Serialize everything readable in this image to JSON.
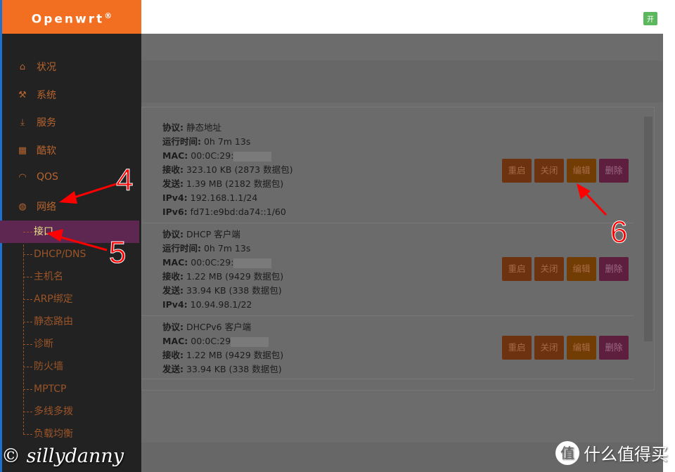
{
  "sidebar": {
    "logo": "Openwrt",
    "logo_mark": "®",
    "menu": [
      {
        "label": "状况",
        "icon": "home-icon"
      },
      {
        "label": "系统",
        "icon": "tools-icon"
      },
      {
        "label": "服务",
        "icon": "download-icon"
      },
      {
        "label": "酷软",
        "icon": "grid-icon"
      },
      {
        "label": "QOS",
        "icon": "gauge-icon"
      },
      {
        "label": "网络",
        "icon": "globe-icon"
      }
    ],
    "submenu": [
      "接口",
      "DHCP/DNS",
      "主机名",
      "ARP绑定",
      "静态路由",
      "诊断",
      "防火墙",
      "MPTCP",
      "多线多拨",
      "负载均衡"
    ],
    "active": "接口"
  },
  "header": {
    "toggle": "开"
  },
  "interfaces": [
    {
      "lines": [
        [
          "协议:",
          "静态地址"
        ],
        [
          "运行时间:",
          "0h 7m 13s"
        ],
        [
          "MAC:",
          "00:0C:29:"
        ],
        [
          "接收:",
          "323.10 KB (2873 数据包)"
        ],
        [
          "发送:",
          "1.39 MB (2182 数据包)"
        ],
        [
          "IPv4:",
          "192.168.1.1/24"
        ],
        [
          "IPv6:",
          "fd71:e9bd:da74::1/60"
        ]
      ]
    },
    {
      "lines": [
        [
          "协议:",
          "DHCP 客户端"
        ],
        [
          "运行时间:",
          "0h 7m 13s"
        ],
        [
          "MAC:",
          "00:0C:29:"
        ],
        [
          "接收:",
          "1.22 MB (9429 数据包)"
        ],
        [
          "发送:",
          "33.94 KB (338 数据包)"
        ],
        [
          "IPv4:",
          "10.94.98.1/22"
        ]
      ]
    },
    {
      "lines": [
        [
          "协议:",
          "DHCPv6 客户端"
        ],
        [
          "MAC:",
          "00:0C:29"
        ],
        [
          "接收:",
          "1.22 MB (9429 数据包)"
        ],
        [
          "发送:",
          "33.94 KB (338 数据包)"
        ]
      ]
    }
  ],
  "buttons": {
    "restart": "重启",
    "close": "关闭",
    "edit": "编辑",
    "delete": "删除"
  },
  "annotations": [
    "4",
    "5",
    "6"
  ],
  "watermark": "© sillydanny",
  "brand": {
    "logo": "值",
    "text": "什么值得买"
  },
  "colors": {
    "orange": "#f26f21",
    "sidebar": "#222222",
    "active": "#5d2751",
    "annotation": "#ff0000"
  }
}
